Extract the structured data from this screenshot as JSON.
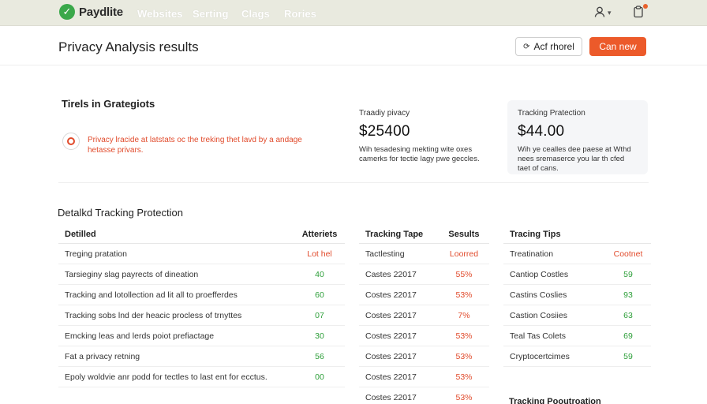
{
  "nav": {
    "brand": "Paydlite",
    "items": [
      "Websites",
      "Serting",
      "Clags",
      "Rories"
    ]
  },
  "header": {
    "title": "Privacy Analysis results",
    "secondary_button": "Acf rhorel",
    "primary_button": "Can new"
  },
  "summary": {
    "title": "Tirels in Grategiots",
    "alert_text": "Privacy lracide at latstats oc the treking thet lavd by a andage hetasse privars.",
    "stats": [
      {
        "label": "Traadiy pivacy",
        "value": "$25400",
        "description": "Wih tesadesing mekting wite oxes camerks for tectie lagy pwe geccles."
      },
      {
        "label": "Tracking Pratection",
        "value": "$44.00",
        "description": "Wih ye cealles dee paese at Wthd nees sremaserce you lar th cfed taet of cans."
      }
    ]
  },
  "detail": {
    "title": "Detalkd Tracking Protection",
    "table1": {
      "headers": [
        "Detilled",
        "Atteriets"
      ],
      "rows": [
        [
          "Treging pratation",
          "Lot hel"
        ],
        [
          "Tarsieginy slag payrects of dineation",
          "40"
        ],
        [
          "Tracking and lotollection ad lit all to proefferdes",
          "60"
        ],
        [
          "Tracking sobs lnd der heacic procless of trnyttes",
          "07"
        ],
        [
          "Emcking leas and lerds poiot prefiactage",
          "30"
        ],
        [
          "Fat a privacy retning",
          "56"
        ],
        [
          "Epoly woldvie anr podd for tectles to last ent for ecctus.",
          "00"
        ]
      ]
    },
    "table2": {
      "headers": [
        "Tracking Tape",
        "Sesults"
      ],
      "rows": [
        [
          "Tactlesting",
          "Loorred"
        ],
        [
          "Castes 22017",
          "55%"
        ],
        [
          "Costes 22017",
          "53%"
        ],
        [
          "Costes 22017",
          "7%"
        ],
        [
          "Costes 22017",
          "53%"
        ],
        [
          "Costes 22017",
          "53%"
        ],
        [
          "Costes 22017",
          "53%"
        ],
        [
          "Costes 22017",
          "53%"
        ]
      ]
    },
    "table3": {
      "headers": [
        "Tracing Tips",
        ""
      ],
      "rows": [
        [
          "Treatination",
          "Cootnet"
        ],
        [
          "Cantiop Costles",
          "59"
        ],
        [
          "Castins Coslies",
          "93"
        ],
        [
          "Castion Cosiies",
          "63"
        ],
        [
          "Teal Tas Colets",
          "69"
        ],
        [
          "Cryptocertcimes",
          "59"
        ]
      ],
      "footer": "Tracking Pooutroation"
    }
  },
  "colors": {
    "accent": "#ec5a2a",
    "positive": "#2e9f3a",
    "negative": "#e14b2c",
    "nav_bg": "#e9eadf"
  },
  "icons": [
    "brand-logo-icon",
    "user-icon",
    "chevron-down-icon",
    "clipboard-icon",
    "refresh-icon",
    "alert-icon"
  ]
}
